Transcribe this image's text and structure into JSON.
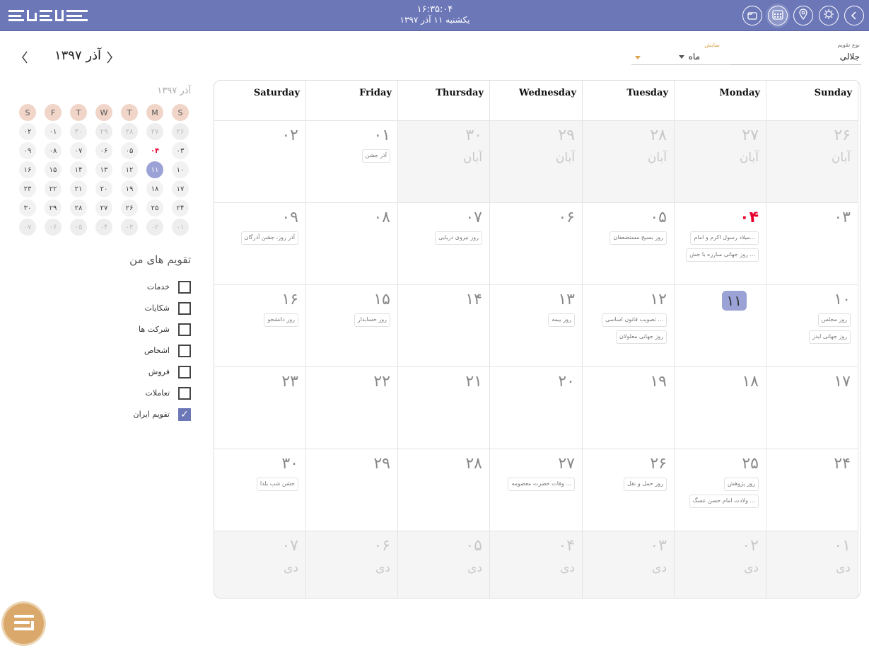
{
  "header": {
    "time": "۱۶:۳۵:۰۴",
    "date": "یکشنبه ۱۱ آذر ۱۳۹۷",
    "icons": [
      "chevron-left-icon",
      "settings-icon",
      "location-icon",
      "calendar-icon",
      "folder-icon"
    ]
  },
  "mini_calendar": {
    "nav_title": "آذر ۱۳۹۷",
    "title": "آذر ۱۳۹۷",
    "weekday_heads": [
      "S",
      "F",
      "T",
      "W",
      "T",
      "M",
      "S"
    ],
    "weeks": [
      [
        "۰۲",
        "۰۱",
        "۳۰",
        "۲۹",
        "۲۸",
        "۲۷",
        "۲۶"
      ],
      [
        "۰۹",
        "۰۸",
        "۰۷",
        "۰۶",
        "۰۵",
        "۰۴",
        "۰۳"
      ],
      [
        "۱۶",
        "۱۵",
        "۱۴",
        "۱۳",
        "۱۲",
        "۱۱",
        "۱۰"
      ],
      [
        "۲۳",
        "۲۲",
        "۲۱",
        "۲۰",
        "۱۹",
        "۱۸",
        "۱۷"
      ],
      [
        "۳۰",
        "۲۹",
        "۲۸",
        "۲۷",
        "۲۶",
        "۲۵",
        "۲۴"
      ],
      [
        "۰۷",
        "۰۶",
        "۰۵",
        "۰۴",
        "۰۳",
        "۰۲",
        "۰۱"
      ]
    ]
  },
  "my_calendars": {
    "title": "تقویم های من",
    "items": [
      {
        "label": "خدمات",
        "checked": false
      },
      {
        "label": "شکایات",
        "checked": false
      },
      {
        "label": "شرکت ها",
        "checked": false
      },
      {
        "label": "اشخاص",
        "checked": false
      },
      {
        "label": "فروش",
        "checked": false
      },
      {
        "label": "تعاملات",
        "checked": false
      },
      {
        "label": "تقویم ایران",
        "checked": true
      }
    ]
  },
  "controls": {
    "calendar_type_caption": "نوع تقویم",
    "calendar_type_value": "جلالی",
    "view_caption": "نمایش",
    "view_value": "ماه"
  },
  "calendar": {
    "weekdays": [
      "Saturday",
      "Friday",
      "Thursday",
      "Wednesday",
      "Tuesday",
      "Monday",
      "Sunday"
    ],
    "weeks": [
      [
        {
          "num": "۰۲",
          "events": []
        },
        {
          "num": "۰۱",
          "events": [
            "آذر جشن"
          ]
        },
        {
          "num": "۳۰",
          "month": "آبان",
          "dim": true,
          "events": []
        },
        {
          "num": "۲۹",
          "month": "آبان",
          "dim": true,
          "events": []
        },
        {
          "num": "۲۸",
          "month": "آبان",
          "dim": true,
          "events": []
        },
        {
          "num": "۲۷",
          "month": "آبان",
          "dim": true,
          "events": []
        },
        {
          "num": "۲۶",
          "month": "آبان",
          "dim": true,
          "events": []
        }
      ],
      [
        {
          "num": "۰۹",
          "events": [
            "آذر روز، جشن آذرگان"
          ]
        },
        {
          "num": "۰۸",
          "events": []
        },
        {
          "num": "۰۷",
          "events": [
            "روز نیروی دریایی"
          ]
        },
        {
          "num": "۰۶",
          "events": []
        },
        {
          "num": "۰۵",
          "events": [
            "روز بسیج مستضعفان"
          ]
        },
        {
          "num": "۰۴",
          "red": true,
          "events": [
            "میلاد رسول اکرم و امام...",
            "روز جهانی مبارزه با جش ..."
          ]
        },
        {
          "num": "۰۳",
          "events": []
        }
      ],
      [
        {
          "num": "۱۶",
          "events": [
            "روز دانشجو"
          ]
        },
        {
          "num": "۱۵",
          "events": [
            "روز حسابدار"
          ]
        },
        {
          "num": "۱۴",
          "events": []
        },
        {
          "num": "۱۳",
          "events": [
            "روز بیمه"
          ]
        },
        {
          "num": "۱۲",
          "events": [
            "تصویب قانون اساسی ...",
            "روز جهانی معلولان"
          ]
        },
        {
          "num": "۱۱",
          "today": true,
          "events": []
        },
        {
          "num": "۱۰",
          "events": [
            "روز مجلس",
            "روز جهانی ایدز"
          ]
        }
      ],
      [
        {
          "num": "۲۳",
          "events": []
        },
        {
          "num": "۲۲",
          "events": []
        },
        {
          "num": "۲۱",
          "events": []
        },
        {
          "num": "۲۰",
          "events": []
        },
        {
          "num": "۱۹",
          "events": []
        },
        {
          "num": "۱۸",
          "events": []
        },
        {
          "num": "۱۷",
          "events": []
        }
      ],
      [
        {
          "num": "۳۰",
          "events": [
            "جشن شب یلدا"
          ]
        },
        {
          "num": "۲۹",
          "events": []
        },
        {
          "num": "۲۸",
          "events": []
        },
        {
          "num": "۲۷",
          "events": [
            "وفات حضرت معصومه ..."
          ]
        },
        {
          "num": "۲۶",
          "events": [
            "روز حمل و نقل"
          ]
        },
        {
          "num": "۲۵",
          "events": [
            "روز پژوهش",
            "ولادت امام حسن عسگ ..."
          ]
        },
        {
          "num": "۲۴",
          "events": []
        }
      ],
      [
        {
          "num": "۰۷",
          "month": "دی",
          "dim": true,
          "events": []
        },
        {
          "num": "۰۶",
          "month": "دی",
          "dim": true,
          "events": []
        },
        {
          "num": "۰۵",
          "month": "دی",
          "dim": true,
          "events": []
        },
        {
          "num": "۰۴",
          "month": "دی",
          "dim": true,
          "events": []
        },
        {
          "num": "۰۳",
          "month": "دی",
          "dim": true,
          "events": []
        },
        {
          "num": "۰۲",
          "month": "دی",
          "dim": true,
          "events": []
        },
        {
          "num": "۰۱",
          "month": "دی",
          "dim": true,
          "events": []
        }
      ]
    ]
  },
  "colors": {
    "header": "#6c77b8",
    "today": "#9aa2d6",
    "holiday": "#e8002d",
    "weekday_head": "#f0d5c8",
    "fab": "#d9a86a"
  }
}
